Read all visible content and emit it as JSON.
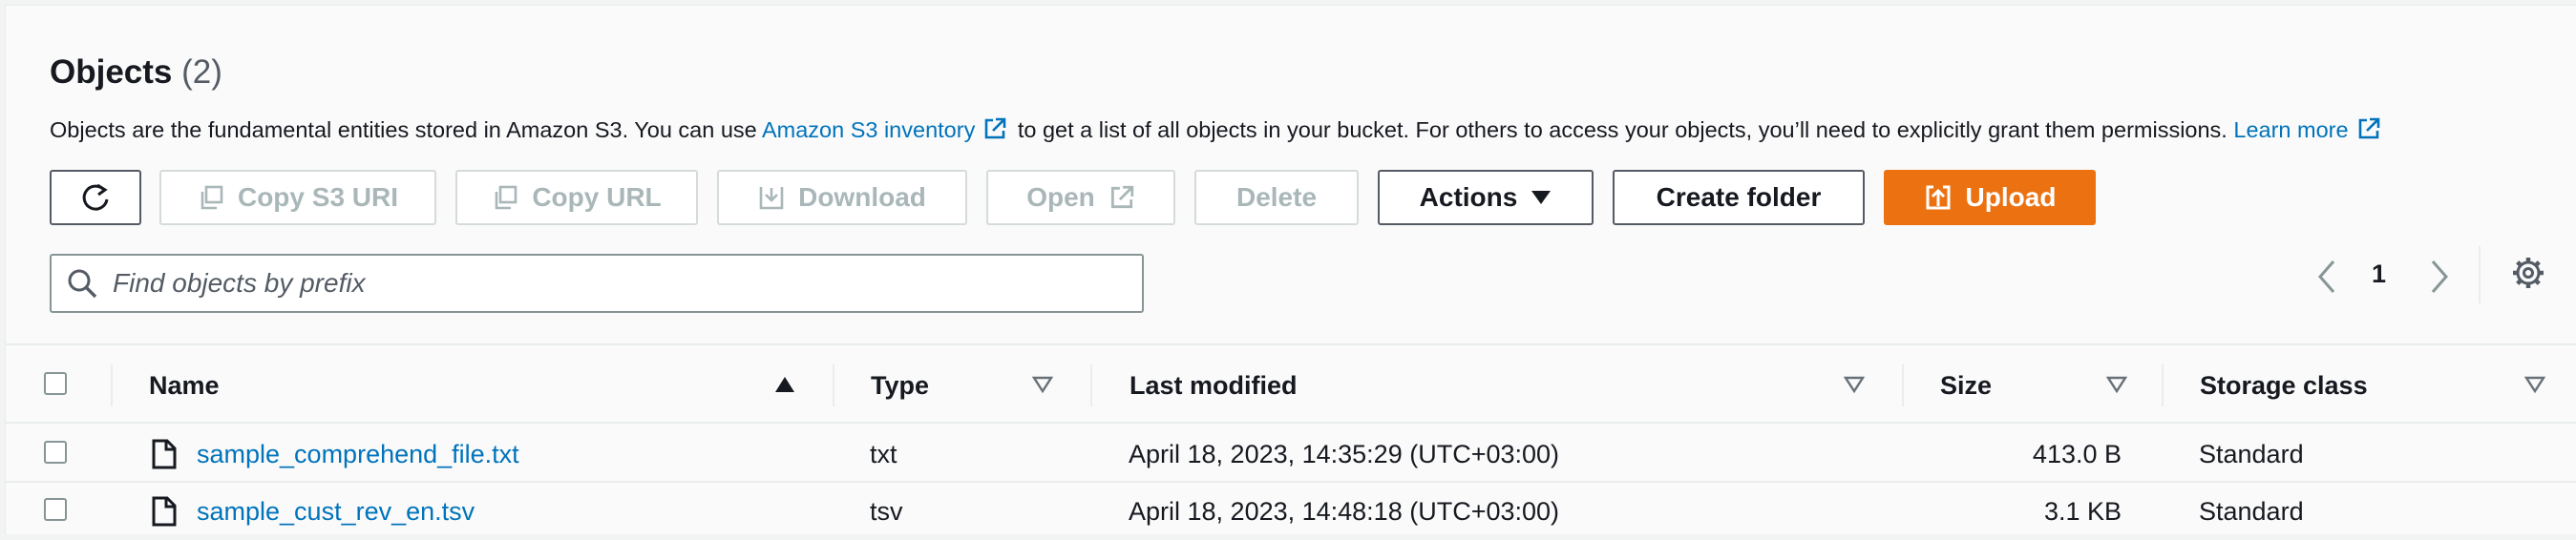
{
  "header": {
    "title": "Objects",
    "count": "(2)"
  },
  "description": {
    "text1": "Objects are the fundamental entities stored in Amazon S3. You can use ",
    "inventory_link": "Amazon S3 inventory",
    "text2": " to get a list of all objects in your bucket. For others to access your objects, you’ll need to explicitly grant them permissions. ",
    "learn_more": "Learn more"
  },
  "toolbar": {
    "copy_s3_uri": "Copy S3 URI",
    "copy_url": "Copy URL",
    "download": "Download",
    "open": "Open",
    "delete": "Delete",
    "actions": "Actions",
    "create_folder": "Create folder",
    "upload": "Upload"
  },
  "search": {
    "placeholder": "Find objects by prefix"
  },
  "pagination": {
    "current_page": "1"
  },
  "table": {
    "columns": {
      "name": "Name",
      "type": "Type",
      "last_modified": "Last modified",
      "size": "Size",
      "storage_class": "Storage class"
    },
    "rows": [
      {
        "name": "sample_comprehend_file.txt",
        "type": "txt",
        "last_modified": "April 18, 2023, 14:35:29 (UTC+03:00)",
        "size": "413.0 B",
        "storage_class": "Standard"
      },
      {
        "name": "sample_cust_rev_en.tsv",
        "type": "tsv",
        "last_modified": "April 18, 2023, 14:48:18 (UTC+03:00)",
        "size": "3.1 KB",
        "storage_class": "Standard"
      }
    ]
  },
  "colors": {
    "link": "#0073bb",
    "primary": "#ec7211",
    "disabled": "#aab7b8",
    "border": "#545b64"
  },
  "icons": [
    "refresh-icon",
    "copy-icon",
    "download-icon",
    "external-link-icon",
    "caret-down-icon",
    "upload-icon",
    "search-icon",
    "chevron-left-icon",
    "chevron-right-icon",
    "gear-icon",
    "sort-ascending-icon",
    "sort-icon",
    "file-icon"
  ]
}
